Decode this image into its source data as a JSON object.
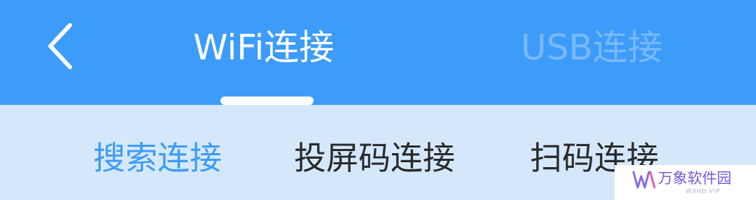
{
  "header": {
    "back_icon": "chevron-left-icon",
    "tabs": [
      {
        "label": "WiFi连接",
        "active": true
      },
      {
        "label": "USB连接",
        "active": false
      }
    ]
  },
  "subtabs": [
    {
      "label": "搜索连接",
      "active": true
    },
    {
      "label": "投屏码连接",
      "active": false
    },
    {
      "label": "扫码连接",
      "active": false
    }
  ],
  "watermark": {
    "title": "万象软件园",
    "subtitle": "WXHD.VIP"
  },
  "colors": {
    "header_bg": "#3d9cf9",
    "subbar_bg": "#d5e8fb",
    "active_text": "#3d9cf9",
    "inactive_header_tab": "#79b9fb"
  }
}
